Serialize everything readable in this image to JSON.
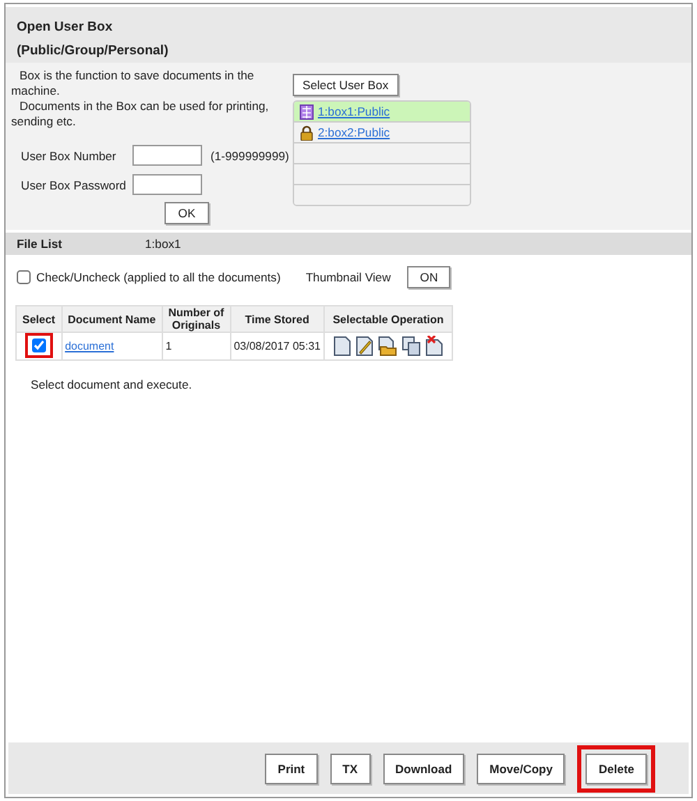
{
  "header": {
    "title": "Open User Box",
    "subtitle": "(Public/Group/Personal)"
  },
  "intro": [
    "Box is the function to save documents in the machine.",
    "Documents in the Box can be used for printing, sending etc."
  ],
  "fields": [
    {
      "label": "User Box Number",
      "hint": "(1-999999999)"
    },
    {
      "label": "User Box Password"
    }
  ],
  "ok_button": "OK",
  "select_button": "Select User Box",
  "boxes": [
    {
      "label": "1:box1:Public",
      "kind": "group",
      "selected": true
    },
    {
      "label": "2:box2:Public",
      "kind": "locked",
      "selected": false
    }
  ],
  "file_list": {
    "title": "File List",
    "box": "1:box1"
  },
  "check_all": {
    "label": "Check/Uncheck (applied to all the documents)",
    "checked": false
  },
  "thumbnail": {
    "label": "Thumbnail View",
    "button": "ON"
  },
  "table": {
    "columns": [
      "Select",
      "Document Name",
      "Number of Originals",
      "Time Stored",
      "Selectable Operation"
    ],
    "rows": [
      {
        "checked": true,
        "highlighted": true,
        "name": "document",
        "originals": "1",
        "time": "03/08/2017 05:31",
        "operations": [
          {
            "kind": "view"
          },
          {
            "kind": "edit"
          },
          {
            "kind": "folder"
          },
          {
            "kind": "copy"
          },
          {
            "kind": "delete"
          }
        ]
      }
    ]
  },
  "instruction": "Select document and execute.",
  "actions": [
    {
      "label": "Print",
      "highlighted": false
    },
    {
      "label": "TX",
      "highlighted": false
    },
    {
      "label": "Download",
      "highlighted": false
    },
    {
      "label": "Move/Copy",
      "highlighted": false
    },
    {
      "label": "Delete",
      "highlighted": true
    }
  ]
}
